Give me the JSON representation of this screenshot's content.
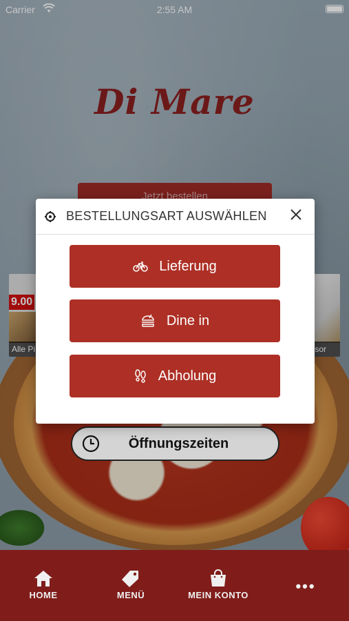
{
  "status_bar": {
    "carrier": "Carrier",
    "time": "2:55 AM"
  },
  "logo_text": "Di Mare",
  "top_button": {
    "label": "Jetzt bestellen"
  },
  "side_cards": {
    "left": {
      "price": "9.00",
      "caption": "Alle Pi"
    },
    "right": {
      "caption": "elsor"
    }
  },
  "hours_button": {
    "label": "Öffnungszeiten",
    "icon": "clock-icon"
  },
  "modal": {
    "title": "BESTELLUNGSART AUSWÄHLEN",
    "options": [
      {
        "label": "Lieferung",
        "icon": "bicycle-icon"
      },
      {
        "label": "Dine in",
        "icon": "burger-icon"
      },
      {
        "label": "Abholung",
        "icon": "footsteps-icon"
      }
    ]
  },
  "tabbar": {
    "items": [
      {
        "label": "HOME",
        "icon": "home-icon"
      },
      {
        "label": "MENÜ",
        "icon": "tag-icon"
      },
      {
        "label": "MEIN KONTO",
        "icon": "shopping-bag-icon"
      },
      {
        "label": "•••",
        "icon": "more-icon"
      }
    ]
  },
  "colors": {
    "primary": "#ad2f25",
    "tabbar": "#801d1a",
    "logo": "#8a1f1f"
  }
}
